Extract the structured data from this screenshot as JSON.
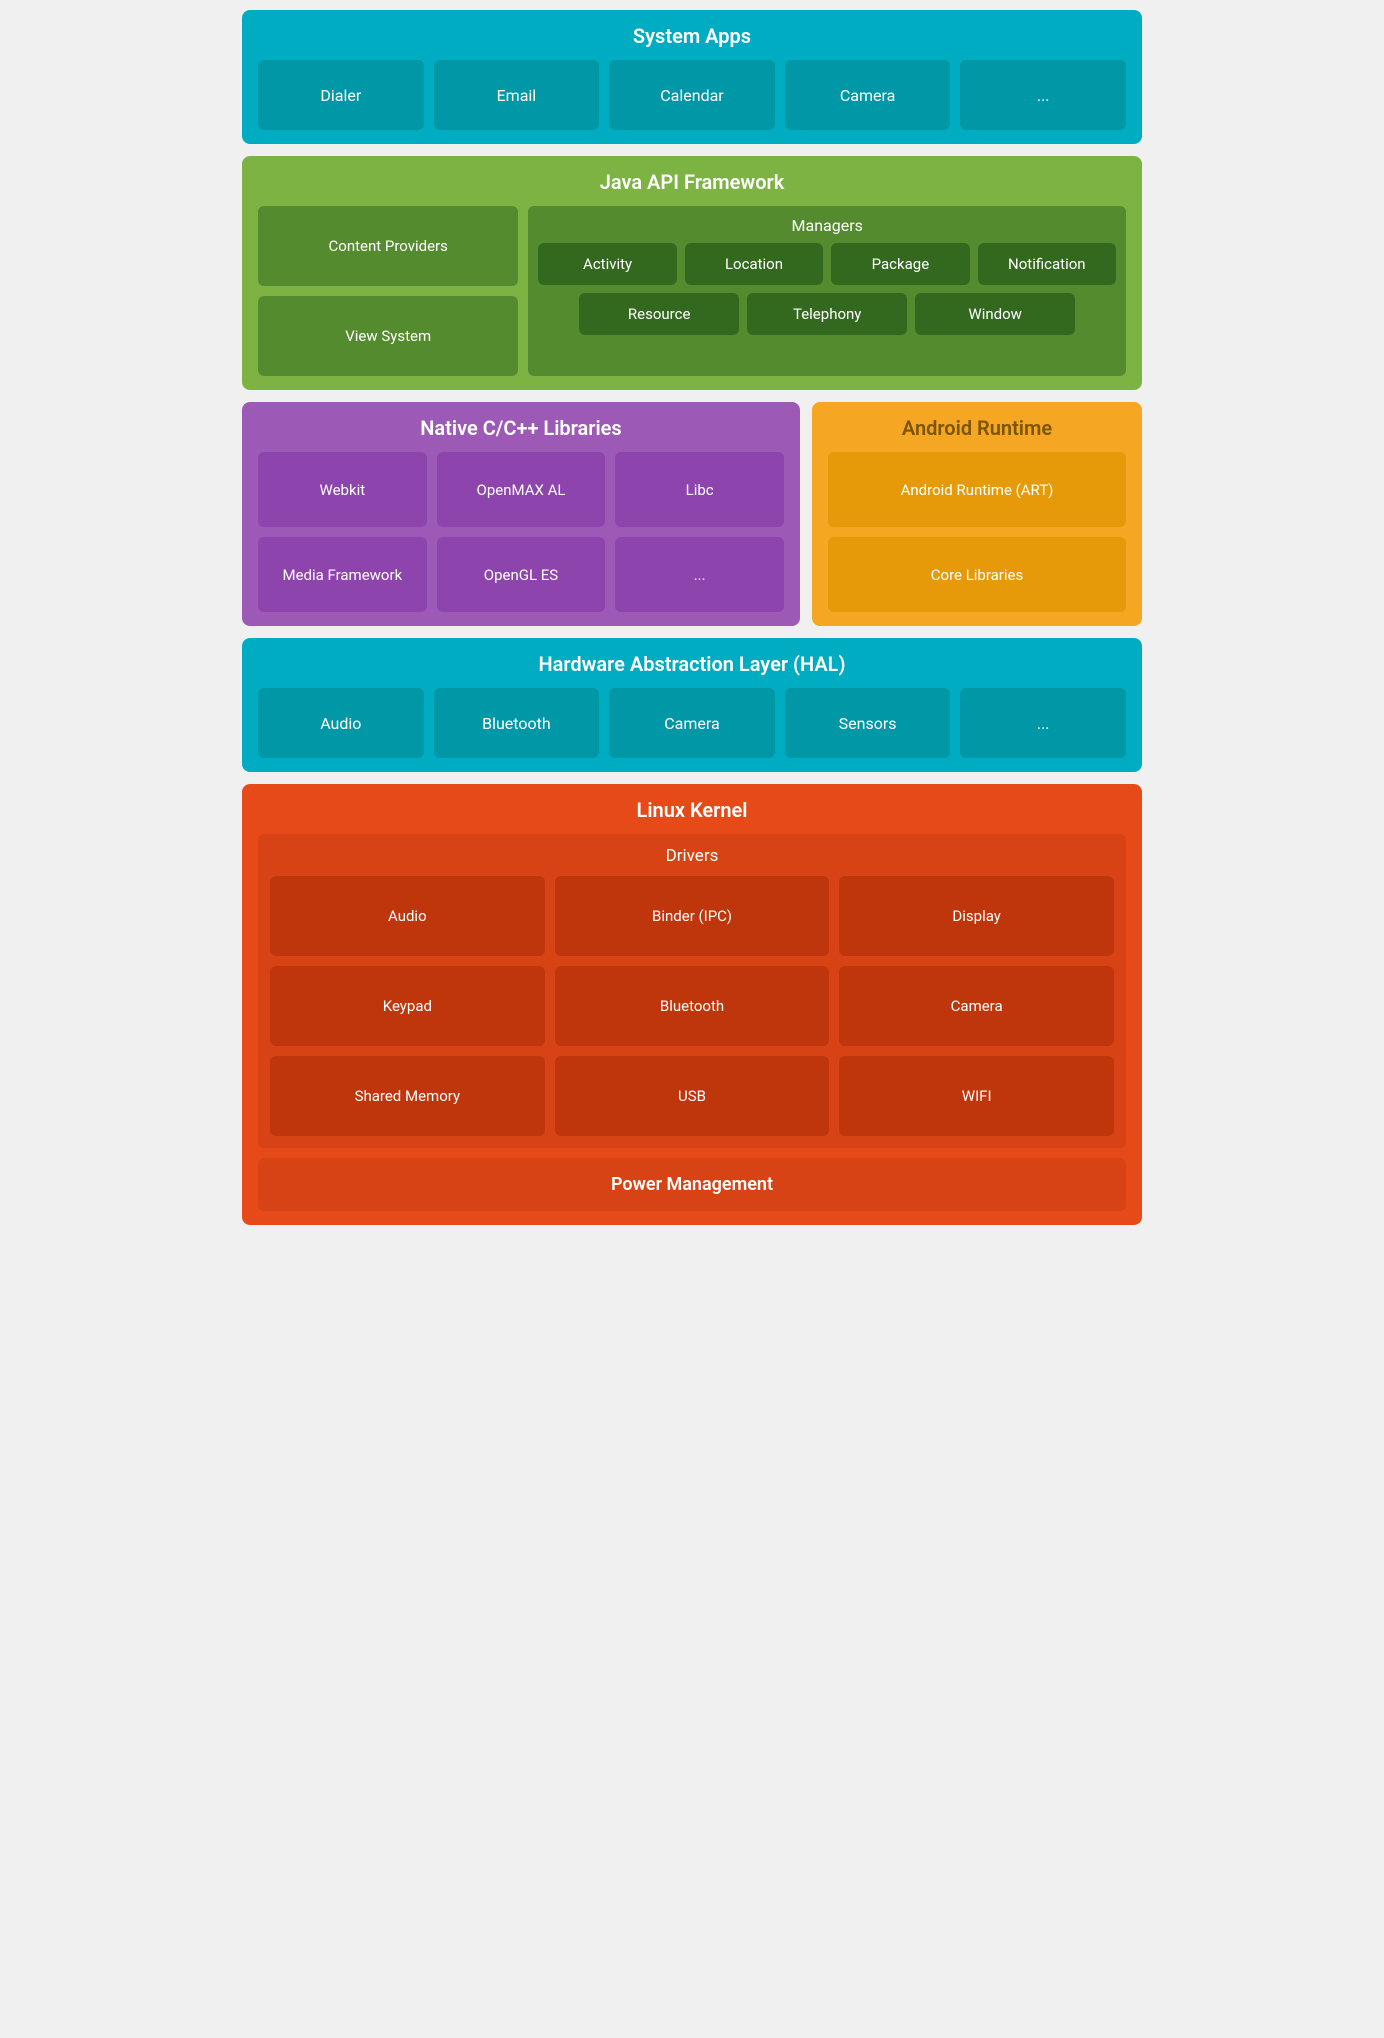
{
  "system_apps": {
    "title": "System Apps",
    "tiles": [
      "Dialer",
      "Email",
      "Calendar",
      "Camera",
      "..."
    ]
  },
  "java_api": {
    "title": "Java API Framework",
    "left_tiles": [
      "Content Providers",
      "View System"
    ],
    "managers": {
      "title": "Managers",
      "row1": [
        "Activity",
        "Location",
        "Package",
        "Notification"
      ],
      "row2": [
        "Resource",
        "Telephony",
        "Window"
      ]
    }
  },
  "native": {
    "title": "Native C/C++ Libraries",
    "tiles": [
      "Webkit",
      "OpenMAX AL",
      "Libc",
      "Media Framework",
      "OpenGL ES",
      "..."
    ]
  },
  "runtime": {
    "title": "Android Runtime",
    "tiles": [
      "Android Runtime (ART)",
      "Core Libraries"
    ]
  },
  "hal": {
    "title": "Hardware Abstraction Layer (HAL)",
    "tiles": [
      "Audio",
      "Bluetooth",
      "Camera",
      "Sensors",
      "..."
    ]
  },
  "linux": {
    "title": "Linux Kernel",
    "drivers_title": "Drivers",
    "drivers": [
      "Audio",
      "Binder (IPC)",
      "Display",
      "Keypad",
      "Bluetooth",
      "Camera",
      "Shared Memory",
      "USB",
      "WIFI"
    ],
    "power_management": "Power Management"
  }
}
